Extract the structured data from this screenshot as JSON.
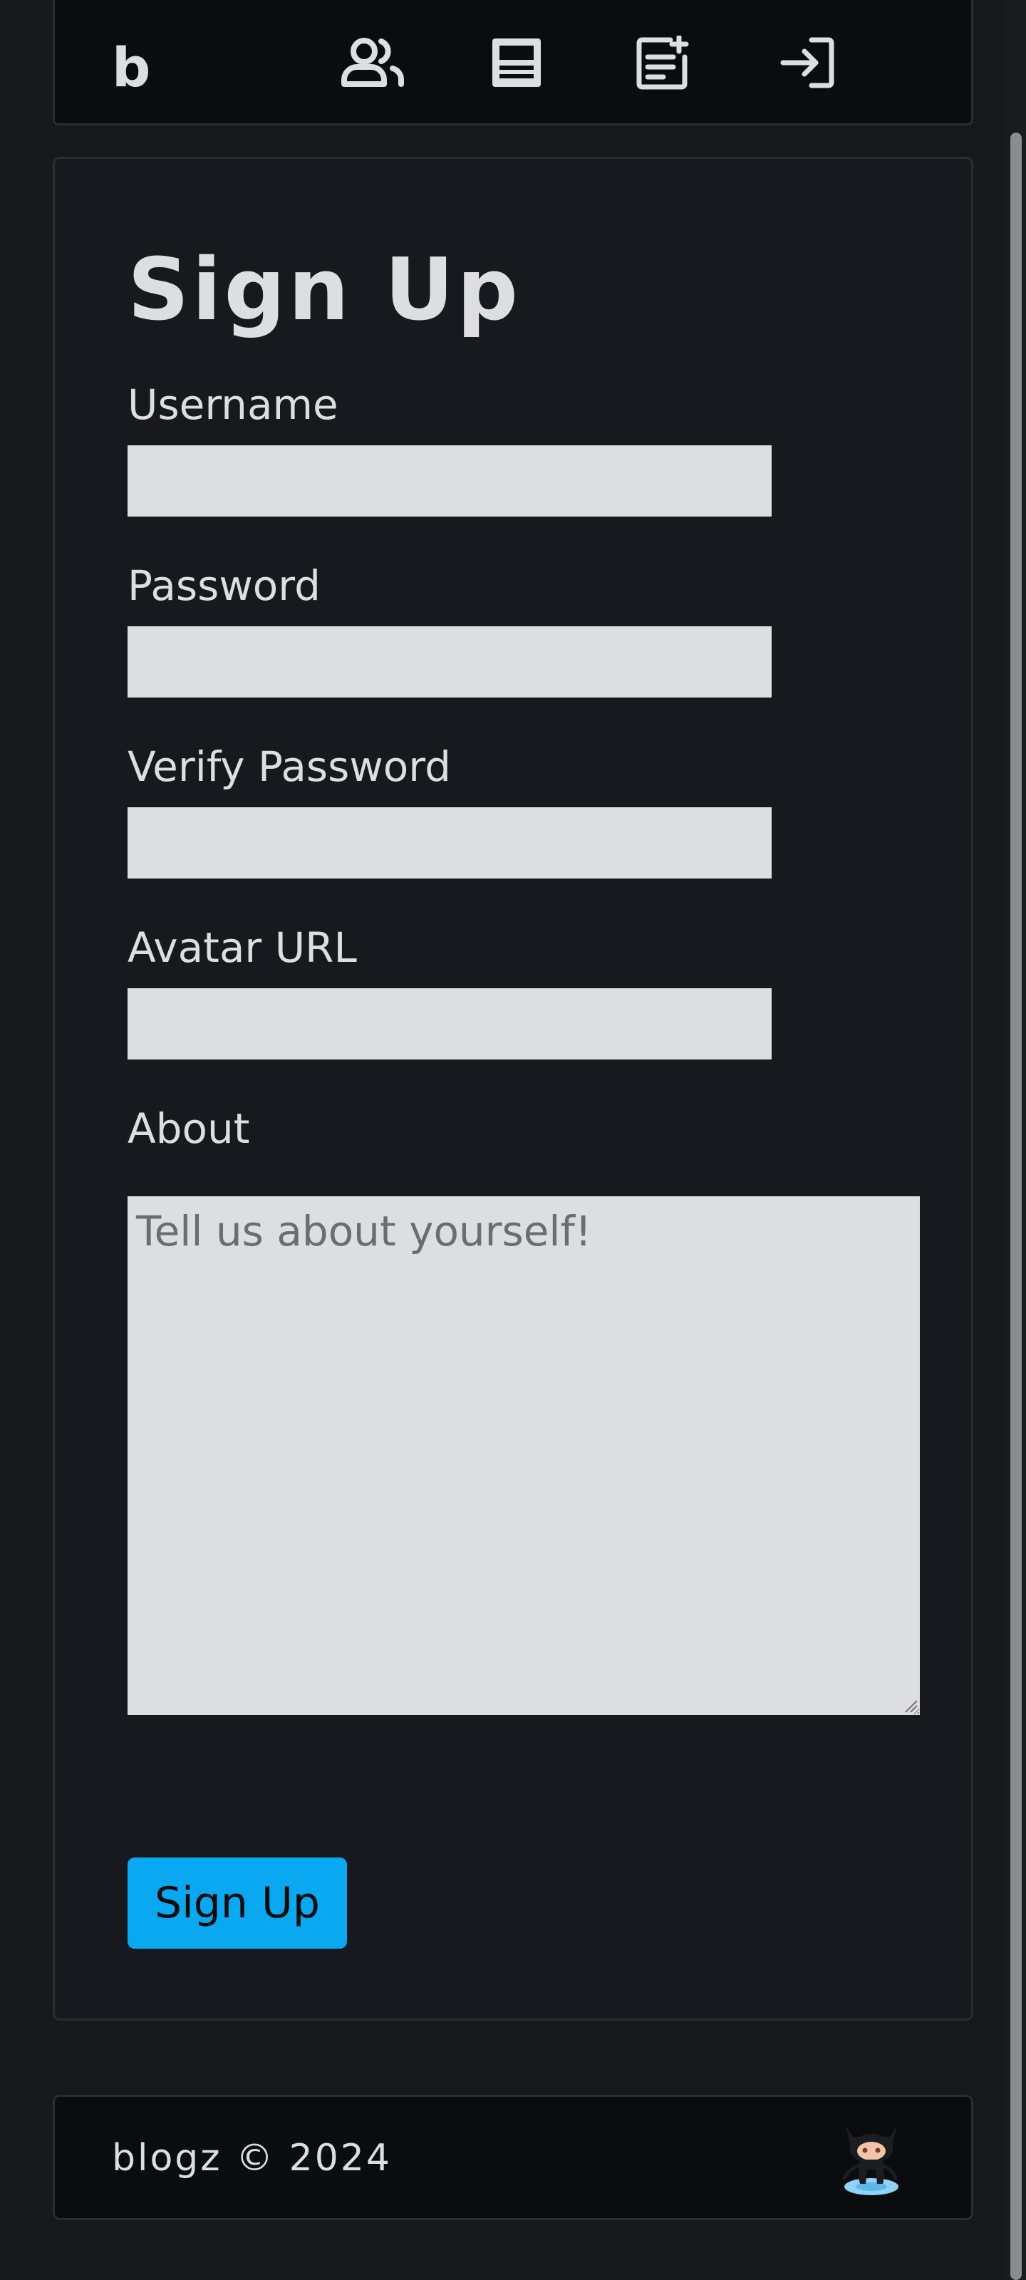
{
  "navbar": {
    "brand": "b",
    "icons": [
      "users-icon",
      "posts-icon",
      "new-post-icon",
      "login-icon"
    ]
  },
  "form": {
    "title": "Sign Up",
    "username_label": "Username",
    "username_value": "",
    "password_label": "Password",
    "password_value": "",
    "verify_password_label": "Verify Password",
    "verify_password_value": "",
    "avatar_label": "Avatar URL",
    "avatar_value": "",
    "about_label": "About",
    "about_placeholder": "Tell us about yourself!",
    "submit_label": "Sign Up"
  },
  "footer": {
    "text": "blogz © 2024",
    "icon": "github-octocat-icon"
  },
  "colors": {
    "background": "#17181c",
    "accent": "#0aa8f0",
    "input_bg": "#dcdee2",
    "text": "#dcdee2"
  }
}
